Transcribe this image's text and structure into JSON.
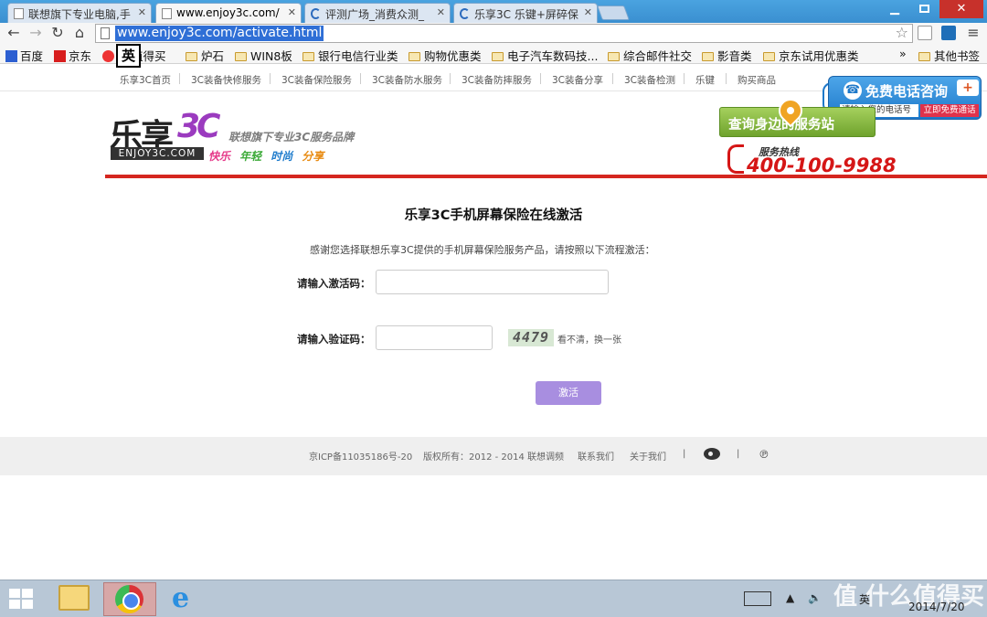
{
  "browser": {
    "tabs": [
      {
        "label": "联想旗下专业电脑,手"
      },
      {
        "label": "www.enjoy3c.com/"
      },
      {
        "label": "评测广场_消费众测_"
      },
      {
        "label": "乐享3C 乐键+屏碎保"
      }
    ],
    "url": "www.enjoy3c.com/activate.html",
    "bookmarks": [
      "百度",
      "京东",
      "值得买",
      "炉石",
      "WIN8板",
      "银行电信行业类",
      "购物优惠类",
      "电子汽车数码技...",
      "综合邮件社交",
      "影音类",
      "京东试用优惠类"
    ],
    "bookmarks_more": "»",
    "other_bookmarks": "其他书签",
    "ime_char": "英"
  },
  "site_nav": [
    "乐享3C首页",
    "3C装备快修服务",
    "3C装备保险服务",
    "3C装备防水服务",
    "3C装备防摔服务",
    "3C装备分享",
    "3C装备检测",
    "乐键",
    "购买商品"
  ],
  "header": {
    "logo_main": "乐享",
    "logo_3c": "3C",
    "logo_domain": "ENJOY3C.COM",
    "slogan": "联想旗下专业3C服务品牌",
    "tags": [
      "快乐",
      "年轻",
      "时尚",
      "分享"
    ],
    "tag_colors": [
      "#e53a8a",
      "#39a935",
      "#1f7ccc",
      "#e88b12"
    ],
    "query_btn": "查询身边的服务站",
    "hotline_label": "服务热线",
    "hotline_number": "400-100-9988"
  },
  "call_widget": {
    "title": "免费电话咨询",
    "input_placeholder": "请输入您的电话号",
    "submit": "立即免费通话"
  },
  "form": {
    "title": "乐享3C手机屏幕保险在线激活",
    "intro": "感谢您选择联想乐享3C提供的手机屏幕保险服务产品，请按照以下流程激活：",
    "activation_label": "请输入激活码：",
    "activation_value": "",
    "captcha_label": "请输入验证码：",
    "captcha_value": "",
    "captcha_code": "4479",
    "refresh_text": "看不清，换一张",
    "submit": "激活",
    "submit_color": "#a88ee0"
  },
  "footer": {
    "icp": "京ICP备11035186号-20",
    "copyright": "版权所有：2012 - 2014 联想调频",
    "contact": "联系我们",
    "about": "关于我们",
    "sep": "|"
  },
  "taskbar": {
    "ime": "英",
    "time": "2014/7/20",
    "watermark": "值 什么值得买"
  }
}
